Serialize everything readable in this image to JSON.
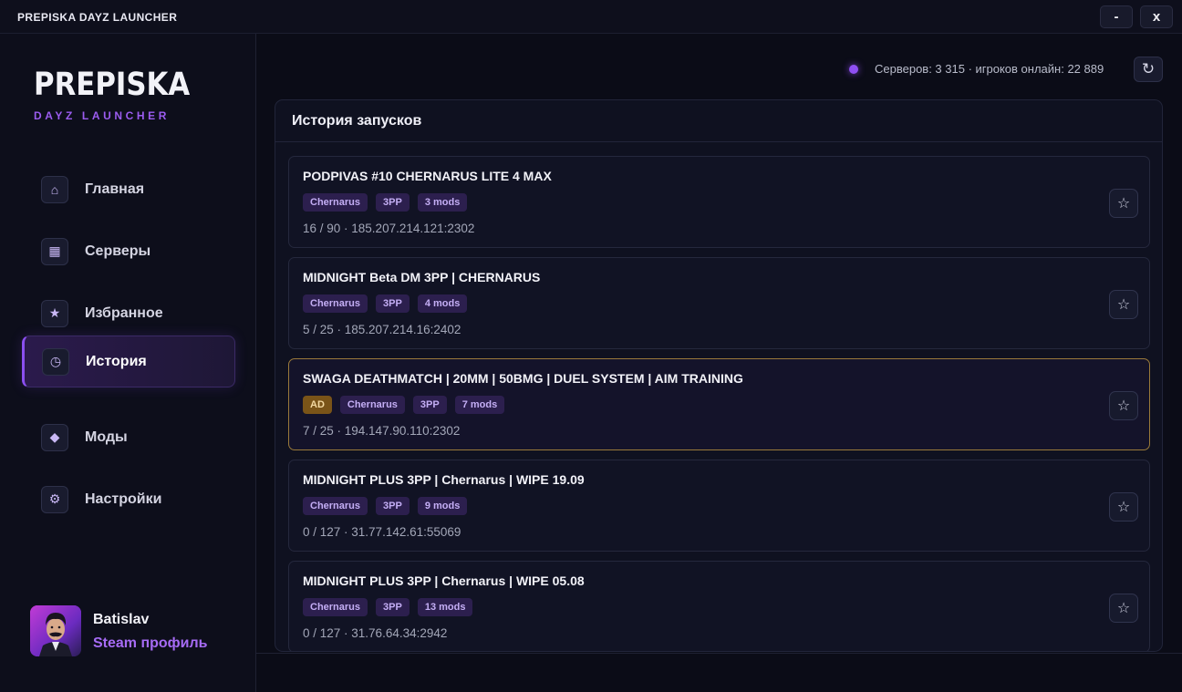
{
  "window": {
    "title": "PREPISKA DAYZ LAUNCHER",
    "minimize_label": "-",
    "close_label": "x"
  },
  "sidebar": {
    "logo": "PREPISKA",
    "logo_sub": "DAYZ LAUNCHER",
    "items": [
      {
        "label": "Главная",
        "icon": "home-icon",
        "glyph": "⌂",
        "active": false
      },
      {
        "label": "Серверы",
        "icon": "grid-icon",
        "glyph": "▦",
        "active": false
      },
      {
        "label": "Избранное",
        "icon": "star-icon",
        "glyph": "★",
        "active": false
      },
      {
        "label": "История",
        "icon": "clock-icon",
        "glyph": "◷",
        "active": true
      },
      {
        "label": "Моды",
        "icon": "diamond-icon",
        "glyph": "◆",
        "active": false
      },
      {
        "label": "Настройки",
        "icon": "gear-icon",
        "glyph": "⚙",
        "active": false
      }
    ],
    "profile": {
      "name": "Batislav",
      "link": "Steam профиль"
    }
  },
  "header": {
    "status": "Серверов: 3 315 · игроков онлайн: 22 889",
    "status_color": "#8f4ff3",
    "refresh_glyph": "↻"
  },
  "history": {
    "title": "История запусков",
    "star_glyph": "☆",
    "servers": [
      {
        "name": "PODPIVAS #10 CHERNARUS LITE 4 MAX",
        "ad": false,
        "tags": [
          "Chernarus",
          "3PP",
          "3 mods"
        ],
        "meta": "16 / 90 · 185.207.214.121:2302"
      },
      {
        "name": "MIDNIGHT Beta DM 3PP | CHERNARUS",
        "ad": false,
        "tags": [
          "Chernarus",
          "3PP",
          "4 mods"
        ],
        "meta": "5 / 25 · 185.207.214.16:2402"
      },
      {
        "name": "SWAGA DEATHMATCH | 20MM | 50BMG | DUEL SYSTEM | AIM TRAINING",
        "ad": true,
        "ad_label": "AD",
        "tags": [
          "Chernarus",
          "3PP",
          "7 mods"
        ],
        "meta": "7 / 25 · 194.147.90.110:2302"
      },
      {
        "name": "MIDNIGHT PLUS 3PP | Chernarus | WIPE 19.09",
        "ad": false,
        "tags": [
          "Chernarus",
          "3PP",
          "9 mods"
        ],
        "meta": "0 / 127 · 31.77.142.61:55069"
      },
      {
        "name": "MIDNIGHT PLUS 3PP | Chernarus | WIPE 05.08",
        "ad": false,
        "tags": [
          "Chernarus",
          "3PP",
          "13 mods"
        ],
        "meta": "0 / 127 · 31.76.64.34:2942"
      }
    ]
  },
  "colors": {
    "accent": "#8b4ff0",
    "ad_border": "#9a7a3a",
    "background": "#0b0c17"
  }
}
